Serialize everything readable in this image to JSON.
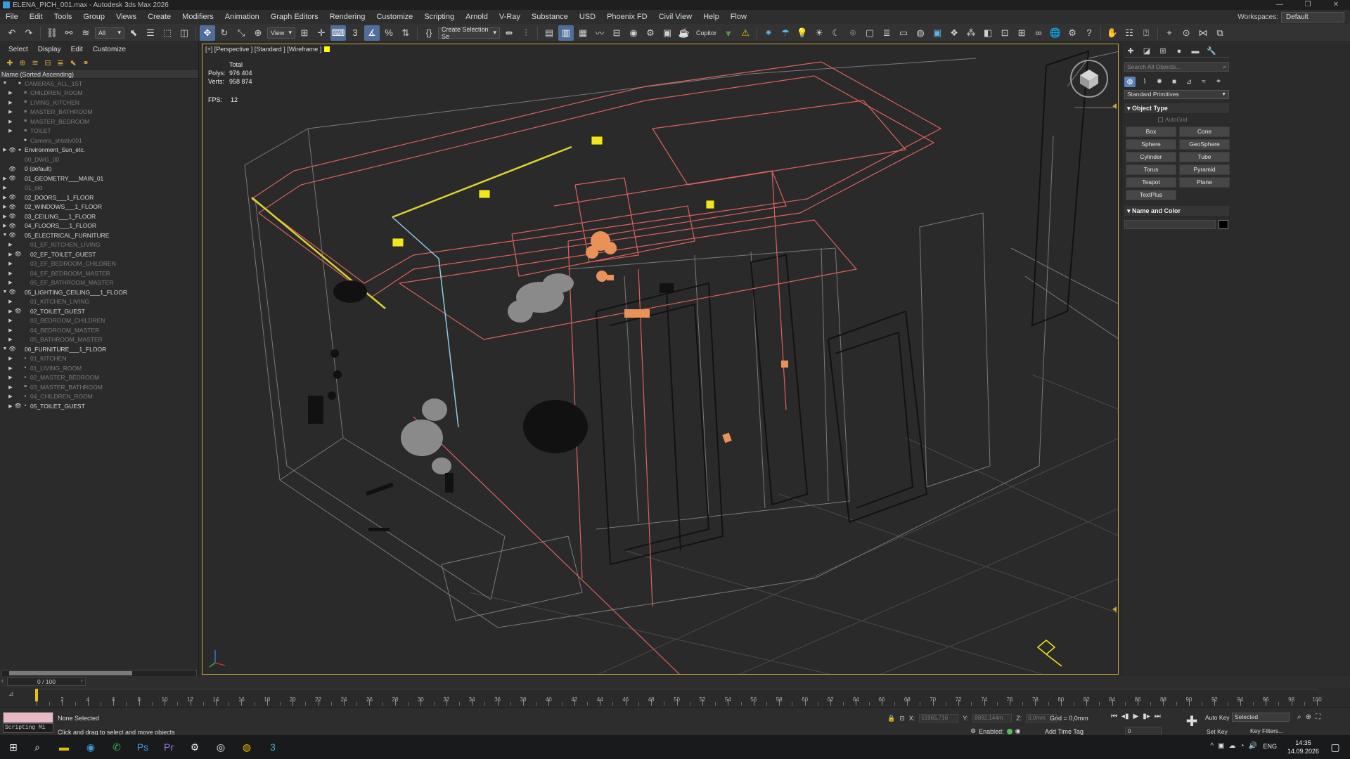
{
  "titlebar": {
    "title": "ELENA_PICH_001.max - Autodesk 3ds Max 2026",
    "controls": [
      "—",
      "❐",
      "✕"
    ]
  },
  "menubar": {
    "items": [
      "File",
      "Edit",
      "Tools",
      "Group",
      "Views",
      "Create",
      "Modifiers",
      "Animation",
      "Graph Editors",
      "Rendering",
      "Customize",
      "Scripting",
      "Arnold",
      "V-Ray",
      "Substance",
      "USD",
      "Phoenix FD",
      "Civil View",
      "Help",
      "Flow"
    ],
    "workspaces_label": "Workspaces:",
    "workspace_value": "Default"
  },
  "toolbar": {
    "filter_value": "All",
    "coord_system": "View",
    "selection_set_placeholder": "Create Selection Se",
    "copitor_label": "Copitor"
  },
  "explorer": {
    "tabs": [
      "Select",
      "Display",
      "Edit",
      "Customize"
    ],
    "column_header": "Name (Sorted Ascending)",
    "rows": [
      {
        "label": "CAMERAS_ALL_1ST",
        "level": 0,
        "expander": "▼",
        "eye": "",
        "icon": "●",
        "dim": true
      },
      {
        "label": "CHILDREN_ROOM",
        "level": 1,
        "expander": "▶",
        "eye": "",
        "icon": "≡",
        "dim": true
      },
      {
        "label": "LIVING_KITCHEN",
        "level": 1,
        "expander": "▶",
        "eye": "",
        "icon": "≡",
        "dim": true
      },
      {
        "label": "MASTER_BATHROOM",
        "level": 1,
        "expander": "▶",
        "eye": "",
        "icon": "≡",
        "dim": true
      },
      {
        "label": "MASTER_BEDROOM",
        "level": 1,
        "expander": "▶",
        "eye": "",
        "icon": "≡",
        "dim": true
      },
      {
        "label": "TOILET",
        "level": 1,
        "expander": "▶",
        "eye": "",
        "icon": "≡",
        "dim": true
      },
      {
        "label": "Camera_shtativ001",
        "level": 1,
        "expander": "",
        "eye": "",
        "icon": "●",
        "dim": true
      },
      {
        "label": "Environment_Sun_etc.",
        "level": 0,
        "expander": "▶",
        "eye": "👁",
        "icon": "●",
        "dim": false
      },
      {
        "label": "00_DWG_00",
        "level": 0,
        "expander": "",
        "eye": "",
        "icon": "",
        "dim": true
      },
      {
        "label": "0 (default)",
        "level": 0,
        "expander": "",
        "eye": "👁",
        "icon": "",
        "dim": false
      },
      {
        "label": "01_GEOMETRY___MAIN_01",
        "level": 0,
        "expander": "▶",
        "eye": "👁",
        "icon": "",
        "dim": false
      },
      {
        "label": "01_old",
        "level": 0,
        "expander": "▶",
        "eye": "",
        "icon": "",
        "dim": true
      },
      {
        "label": "02_DOORS___1_FLOOR",
        "level": 0,
        "expander": "▶",
        "eye": "👁",
        "icon": "",
        "dim": false
      },
      {
        "label": "02_WINDOWS___1_FLOOR",
        "level": 0,
        "expander": "▶",
        "eye": "👁",
        "icon": "",
        "dim": false
      },
      {
        "label": "03_CEILING___1_FLOOR",
        "level": 0,
        "expander": "▶",
        "eye": "👁",
        "icon": "",
        "dim": false
      },
      {
        "label": "04_FLOORS___1_FLOOR",
        "level": 0,
        "expander": "▶",
        "eye": "👁",
        "icon": "",
        "dim": false
      },
      {
        "label": "05_ELECTRICAL_FURNITURE",
        "level": 0,
        "expander": "▼",
        "eye": "👁",
        "icon": "",
        "dim": false
      },
      {
        "label": "01_EF_KITCHEN_LIVING",
        "level": 1,
        "expander": "▶",
        "eye": "",
        "icon": "",
        "dim": true
      },
      {
        "label": "02_EF_TOILET_GUEST",
        "level": 1,
        "expander": "▶",
        "eye": "👁",
        "icon": "",
        "dim": false
      },
      {
        "label": "03_EF_BEDROOM_CHILDREN",
        "level": 1,
        "expander": "▶",
        "eye": "",
        "icon": "",
        "dim": true
      },
      {
        "label": "04_EF_BEDROOM_MASTER",
        "level": 1,
        "expander": "▶",
        "eye": "",
        "icon": "",
        "dim": true
      },
      {
        "label": "05_EF_BATHROOM_MASTER",
        "level": 1,
        "expander": "▶",
        "eye": "",
        "icon": "",
        "dim": true
      },
      {
        "label": "05_LIGHTING_CEILING___1_FLOOR",
        "level": 0,
        "expander": "▼",
        "eye": "👁",
        "icon": "",
        "dim": false
      },
      {
        "label": "01_KITCHEN_LIVING",
        "level": 1,
        "expander": "▶",
        "eye": "",
        "icon": "",
        "dim": true
      },
      {
        "label": "02_TOILET_GUEST",
        "level": 1,
        "expander": "▶",
        "eye": "👁",
        "icon": "",
        "dim": false
      },
      {
        "label": "03_BEDROOM_CHILDREN",
        "level": 1,
        "expander": "▶",
        "eye": "",
        "icon": "",
        "dim": true
      },
      {
        "label": "04_BEDROOM_MASTER",
        "level": 1,
        "expander": "▶",
        "eye": "",
        "icon": "",
        "dim": true
      },
      {
        "label": "05_BATHROOM_MASTER",
        "level": 1,
        "expander": "▶",
        "eye": "",
        "icon": "",
        "dim": true
      },
      {
        "label": "06_FURNITURE___1_FLOOR",
        "level": 0,
        "expander": "▼",
        "eye": "👁",
        "icon": "",
        "dim": false
      },
      {
        "label": "01_KITCHEN",
        "level": 1,
        "expander": "▶",
        "eye": "",
        "icon": "•",
        "dim": true
      },
      {
        "label": "01_LIVING_ROOM",
        "level": 1,
        "expander": "▶",
        "eye": "",
        "icon": "•",
        "dim": true
      },
      {
        "label": "02_MASTER_BEDROOM",
        "level": 1,
        "expander": "▶",
        "eye": "",
        "icon": "•",
        "dim": true
      },
      {
        "label": "03_MASTER_BATHROOM",
        "level": 1,
        "expander": "▶",
        "eye": "",
        "icon": "≡",
        "dim": true
      },
      {
        "label": "04_CHILDREN_ROOM",
        "level": 1,
        "expander": "▶",
        "eye": "",
        "icon": "•",
        "dim": true
      },
      {
        "label": "05_TOILET_GUEST",
        "level": 1,
        "expander": "▶",
        "eye": "👁",
        "icon": "•",
        "dim": false
      }
    ]
  },
  "viewport": {
    "label": "[+] [Perspective ] [Standard ] [Wireframe ]",
    "stats_total": "Total",
    "polys_label": "Polys:",
    "polys_value": "976 404",
    "verts_label": "Verts:",
    "verts_value": "958 874",
    "fps_label": "FPS:",
    "fps_value": "12",
    "swatch_color": "#ffff00",
    "border_color": "#c9a43a"
  },
  "command_panel": {
    "search_placeholder": "Search All Objects...",
    "category": "Standard Primitives",
    "object_type_title": "Object Type",
    "autogrid_label": "AutoGrid",
    "primitives": [
      "Box",
      "Cone",
      "Sphere",
      "GeoSphere",
      "Cylinder",
      "Tube",
      "Torus",
      "Pyramid",
      "Teapot",
      "Plane",
      "TextPlus"
    ],
    "name_color_title": "Name and Color"
  },
  "timeline": {
    "slider_text": "0 / 100",
    "frame_labels": [
      "0",
      "2",
      "4",
      "6",
      "8",
      "10",
      "12",
      "14",
      "16",
      "18",
      "20",
      "22",
      "24",
      "26",
      "28",
      "30",
      "32",
      "34",
      "36",
      "38",
      "40",
      "42",
      "44",
      "46",
      "48",
      "50",
      "52",
      "54",
      "56",
      "58",
      "60",
      "62",
      "64",
      "66",
      "68",
      "70",
      "72",
      "74",
      "76",
      "78",
      "80",
      "82",
      "84",
      "86",
      "88",
      "90",
      "92",
      "94",
      "96",
      "98",
      "100"
    ]
  },
  "status": {
    "maxscript_label": "Scripting Mi",
    "selection_text": "None Selected",
    "prompt_text": "Click and drag to select and move objects",
    "x_label": "X:",
    "x_value": "51965,716",
    "y_label": "Y:",
    "y_value": "8892,144m",
    "z_label": "Z:",
    "z_value": "0,0mm",
    "grid_text": "Grid = 0,0mm",
    "enabled_label": "Enabled:",
    "add_time_tag": "Add Time Tag",
    "frame_value": "0",
    "auto_key": "Auto Key",
    "set_key": "Set Key",
    "selected_value": "Selected",
    "key_filters": "Key Filters..."
  },
  "taskbar": {
    "lang": "ENG",
    "time": "14:35",
    "date": "14.09.2026"
  }
}
